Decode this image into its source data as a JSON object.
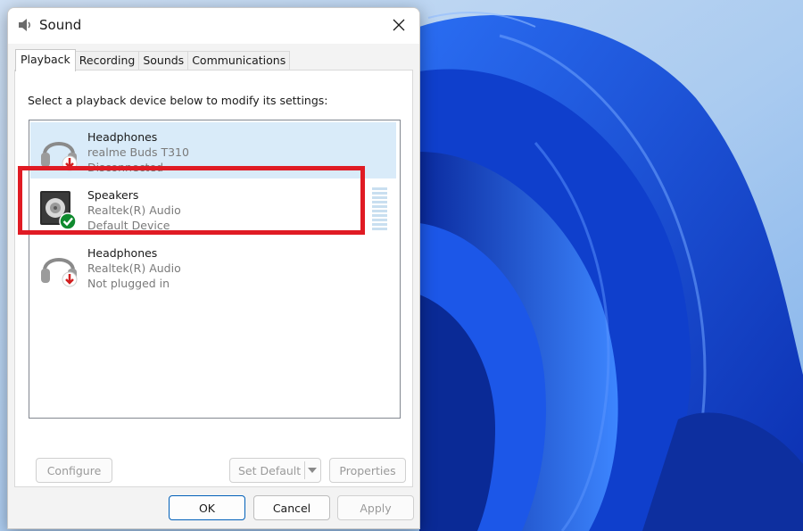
{
  "window": {
    "title": "Sound",
    "icon": "speaker-icon",
    "close_icon": "close-icon"
  },
  "tabs": [
    {
      "label": "Playback",
      "active": true
    },
    {
      "label": "Recording",
      "active": false
    },
    {
      "label": "Sounds",
      "active": false
    },
    {
      "label": "Communications",
      "active": false
    }
  ],
  "playback": {
    "instructions": "Select a playback device below to modify its settings:",
    "devices": [
      {
        "name": "Headphones",
        "driver": "realme Buds T310",
        "status": "Disconnected",
        "icon": "headphones-icon",
        "badge": "red-down-arrow-icon",
        "selected": true
      },
      {
        "name": "Speakers",
        "driver": "Realtek(R) Audio",
        "status": "Default Device",
        "icon": "speaker-icon",
        "badge": "green-check-icon",
        "selected": false,
        "level": 0
      },
      {
        "name": "Headphones",
        "driver": "Realtek(R) Audio",
        "status": "Not plugged in",
        "icon": "headphones-icon",
        "badge": "red-down-arrow-icon",
        "selected": false
      }
    ],
    "buttons": {
      "configure": "Configure",
      "set_default": "Set Default",
      "properties": "Properties"
    }
  },
  "footer": {
    "ok": "OK",
    "cancel": "Cancel",
    "apply": "Apply"
  },
  "colors": {
    "highlight_box": "#e01b24",
    "selection": "#d9ebf9",
    "accent": "#005fb8",
    "default_badge": "#0f8a2e",
    "disconnected_badge": "#d11f1f"
  }
}
